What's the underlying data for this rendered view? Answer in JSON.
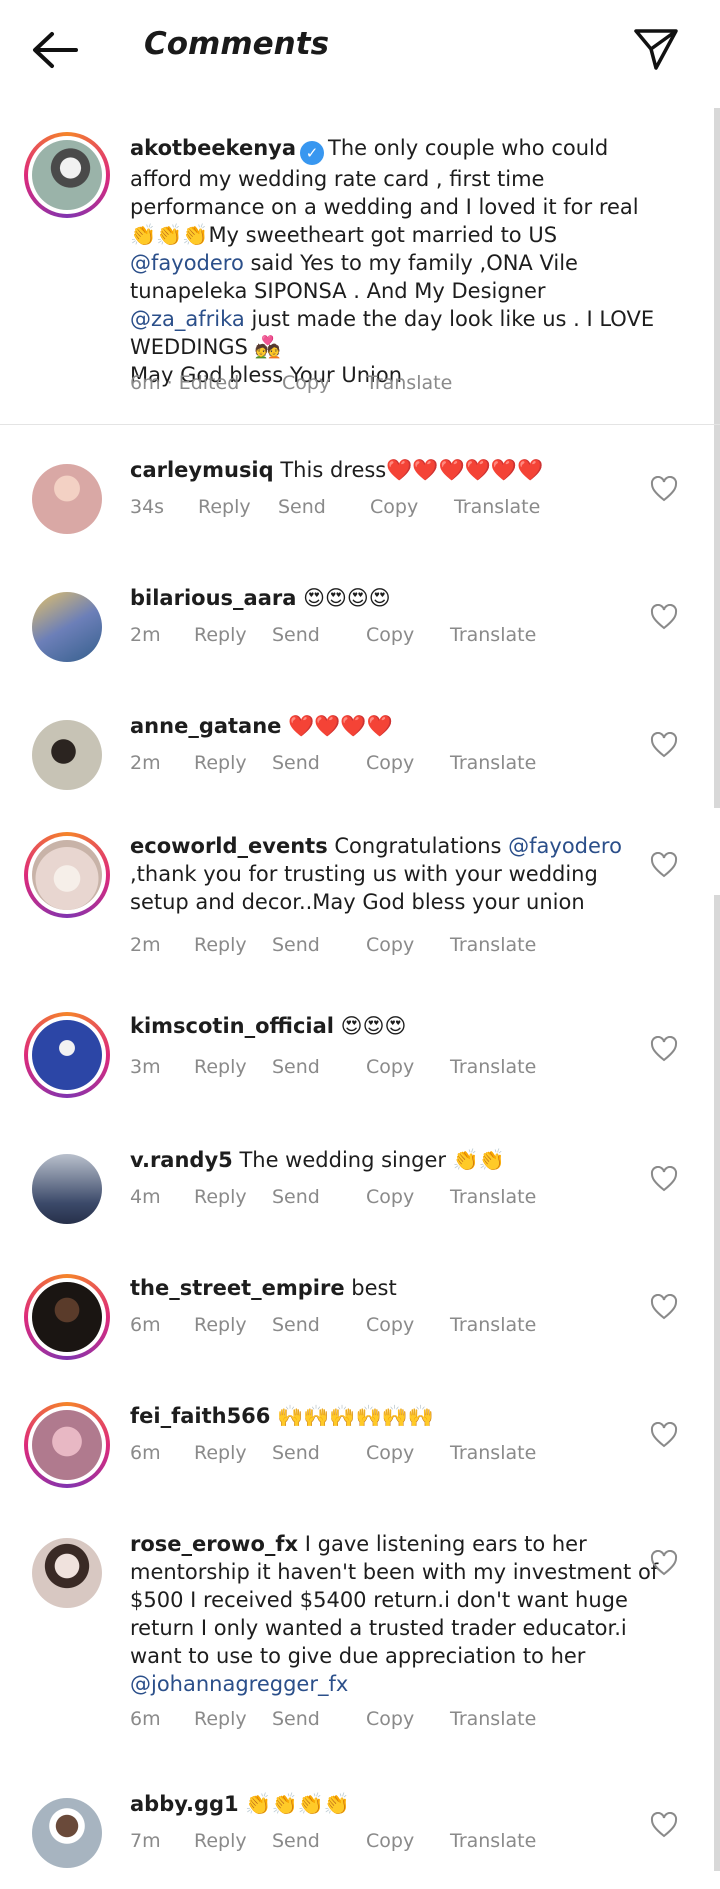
{
  "header": {
    "title": "Comments"
  },
  "caption": {
    "username": "akotbeekenya",
    "verified": true,
    "text_1": "The only couple who could afford my wedding rate card , first time performance on a wedding and I loved it for real 👏👏👏My sweetheart got married to US ",
    "mention_1": "@fayodero",
    "text_2": " said Yes to my family ,ONA Vile tunapeleka SIPONSA . And My Designer ",
    "mention_2": "@za_afrika",
    "text_3": " just made the day look like us . I LOVE WEDDINGS 💑",
    "text_4": "May God bless Your Union",
    "time": "6m · Edited",
    "copy": "Copy",
    "translate": "Translate"
  },
  "actions": {
    "reply": "Reply",
    "send": "Send",
    "copy": "Copy",
    "translate": "Translate"
  },
  "comments": [
    {
      "username": "carleymusiq",
      "text": "This dress❤️❤️❤️❤️❤️❤️",
      "time": "34s",
      "ring": false,
      "avatar_color": "#d9a8a5"
    },
    {
      "username": "bilarious_aara",
      "text": "😍😍😍😍",
      "time": "2m",
      "ring": false,
      "avatar_color": "#6c7fb8"
    },
    {
      "username": "anne_gatane",
      "text": "❤️❤️❤️❤️",
      "time": "2m",
      "ring": false,
      "avatar_color": "#6e7468"
    },
    {
      "username": "ecoworld_events",
      "text": "Congratulations ",
      "mention": "@fayodero",
      "text_after": ",thank you for trusting us with your wedding setup and  decor..May God bless your union",
      "time": "2m",
      "ring": true,
      "avatar_color": "#e8d6d0"
    },
    {
      "username": "kimscotin_official",
      "text": "😍😍😍",
      "time": "3m",
      "ring": true,
      "avatar_color": "#2c46a6"
    },
    {
      "username": "v.randy5",
      "text": "The wedding singer 👏👏",
      "time": "4m",
      "ring": false,
      "avatar_color": "#3c4a6a"
    },
    {
      "username": "the_street_empire",
      "text": "best",
      "time": "6m",
      "ring": true,
      "avatar_color": "#3b2b22"
    },
    {
      "username": "fei_faith566",
      "text": "🙌🙌🙌🙌🙌🙌",
      "time": "6m",
      "ring": true,
      "avatar_color": "#b07a8e"
    },
    {
      "username": "rose_erowo_fx",
      "text": "I gave listening ears to her mentorship it haven't been with my investment of $500 I received $5400 return.i don't want huge return I only wanted a trusted trader educator.i want to use to give due appreciation to her ",
      "mention": "@johannagregger_fx",
      "time": "6m",
      "ring": false,
      "avatar_color": "#d8c8c2"
    },
    {
      "username": "abby.gg1",
      "text": "👏👏👏👏",
      "time": "7m",
      "ring": false,
      "avatar_color": "#a7b4c0"
    }
  ]
}
